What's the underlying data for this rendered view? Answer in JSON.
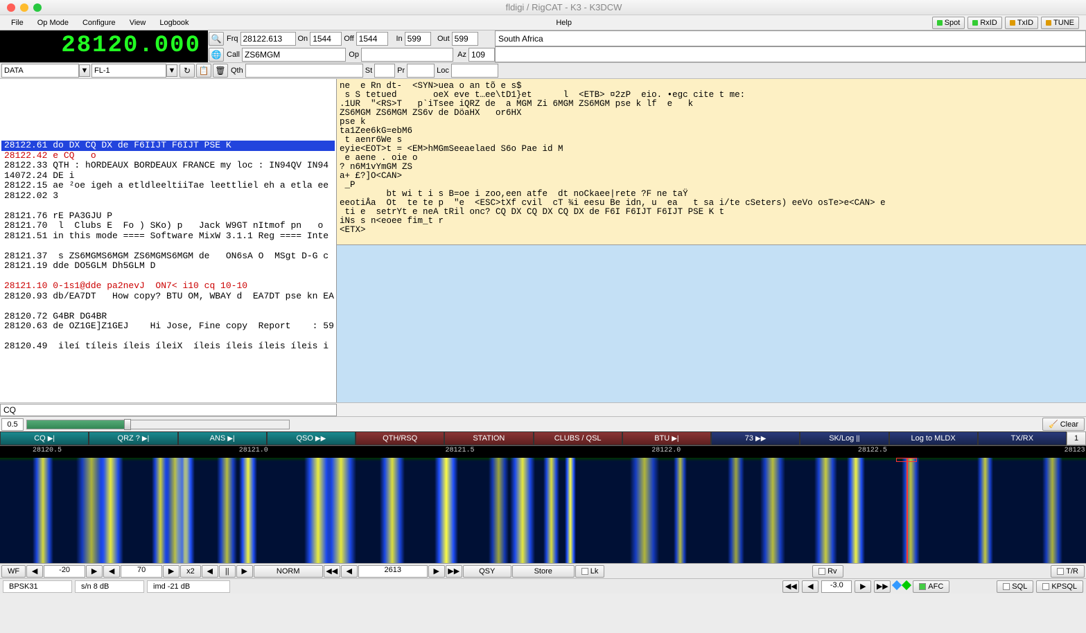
{
  "title": "fldigi / RigCAT - K3 - K3DCW",
  "menu": [
    "File",
    "Op Mode",
    "Configure",
    "View",
    "Logbook",
    "Help"
  ],
  "indicators": [
    {
      "label": "Spot",
      "led": "green"
    },
    {
      "label": "RxID",
      "led": "green"
    },
    {
      "label": "TxID",
      "led": "amber"
    },
    {
      "label": "TUNE",
      "led": "amber"
    }
  ],
  "frequency_display": "28120.000",
  "fields": {
    "frq": "28122.613",
    "on": "1544",
    "off": "1544",
    "in": "599",
    "out": "599",
    "notes": "South Africa",
    "call": "ZS6MGM",
    "op": "",
    "az": "109",
    "qth": ""
  },
  "labels": {
    "frq": "Frq",
    "on": "On",
    "off": "Off",
    "in": "In",
    "out": "Out",
    "call": "Call",
    "op": "Op",
    "az": "Az",
    "qth": "Qth",
    "st": "St",
    "pr": "Pr",
    "loc": "Loc"
  },
  "mode_dd": "DATA",
  "filter_dd": "FL-1",
  "signals": [
    {
      "t": ""
    },
    {
      "t": ""
    },
    {
      "t": ""
    },
    {
      "t": ""
    },
    {
      "t": ""
    },
    {
      "t": ""
    },
    {
      "t": "28122.61 do DX CQ DX de F6IIJT F6IJT PSE K",
      "sel": true
    },
    {
      "t": "28122.42 e CQ   o",
      "red": true
    },
    {
      "t": "28122.33 QTH : hORDEAUX BORDEAUX FRANCE my loc : IN94QV IN94"
    },
    {
      "t": "14072.24 DE i"
    },
    {
      "t": "28122.15 ae ²oe igeh a etldleeltiiTae leettliel eh a etla ee"
    },
    {
      "t": "28122.02 3"
    },
    {
      "t": ""
    },
    {
      "t": "28121.76 rE PA3GJU P"
    },
    {
      "t": "28121.70  l  Clubs E  Fo ) SKo) p   Jack W9GT nItmof pn   o"
    },
    {
      "t": "28121.51 in this mode ==== Software MixW 3.1.1 Reg ==== Inte"
    },
    {
      "t": ""
    },
    {
      "t": "28121.37  s ZS6MGMS6MGM ZS6MGMS6MGM de   ON6sA O  MSgt D-G c"
    },
    {
      "t": "28121.19 dde DO5GLM Dh5GLM D"
    },
    {
      "t": ""
    },
    {
      "t": "28121.10 0-1s1@dde pa2nevJ  ON7< i10 cq 10-10",
      "red": true
    },
    {
      "t": "28120.93 db/EA7DT   How copy? BTU OM, WBAY d  EA7DT pse kn EA"
    },
    {
      "t": ""
    },
    {
      "t": "28120.72 G4BR DG4BR"
    },
    {
      "t": "28120.63 de OZ1GE]Z1GEJ    Hi Jose, Fine copy  Report    : 59"
    },
    {
      "t": ""
    },
    {
      "t": "28120.49  ileí tíleis íleis íleiX  íleis íleis íleis íleis i"
    }
  ],
  "rxtext": "ne  e Rn dt-  <SYN>uea o an tõ e s$\n s S tetued       oeX eve t…ee\\tD1}et      l  <ETB> ¤2zP  eio. •egc cite t me:\n.1UR  \"<RS>T   p`iTsee iQRZ de  a MGM Zi 6MGM ZS6MGM pse k lf  e   k\nZS6MGM ZS6MGM ZS6v de DöaHX   or6HX\npse k\nta1Zee6kG=ebM6\n t aenr6We s\neyie<EOT>t = <EM>hMGmSeeaelaed S6o Pae id M\n e aene . oie o\n? n6M1vYmGM ZS\na+ £?]O<CAN>\n _P\n         bt wi t i s B=oe i zoo,een atfe  dt noCkaee|rete ?F ne taŸ\neeotiÅa  Ot  te te p  \"e  <ESC>tXf cvil  cT ¾i eesu Be idn, u  ea   t sa i/te cSeters) eeVo osTe>e<CAN> e\n ti e  setrYt e neA tRil onc? CQ DX CQ DX CQ DX de F6I F6IJT F6IJT PSE K t\niNs s n<eoee fim_t r\n<ETX>",
  "cq_label": "CQ",
  "slider_val": "0.5",
  "clear": "Clear",
  "macros": [
    {
      "l": "CQ",
      "s": "▶|",
      "c": "teal"
    },
    {
      "l": "QRZ ?",
      "s": "▶|",
      "c": "teal"
    },
    {
      "l": "ANS",
      "s": "▶|",
      "c": "teal"
    },
    {
      "l": "QSO",
      "s": "▶▶",
      "c": "teal"
    },
    {
      "l": "QTH/RSQ",
      "c": "red"
    },
    {
      "l": "STATION",
      "c": "red"
    },
    {
      "l": "CLUBS / QSL",
      "c": "red"
    },
    {
      "l": "BTU",
      "s": "▶|",
      "c": "red"
    },
    {
      "l": "73",
      "s": "▶▶",
      "c": "blue"
    },
    {
      "l": "SK/Log",
      "s": "||",
      "c": "blue"
    },
    {
      "l": "Log to MLDX",
      "c": "blue"
    },
    {
      "l": "TX/RX",
      "c": "blue"
    }
  ],
  "macro_page": "1",
  "scale": [
    "28120.5",
    "28121.0",
    "28121.5",
    "28122.0",
    "28122.5",
    "28123.0"
  ],
  "wf": {
    "btn_wf": "WF",
    "brightness": "-20",
    "contrast": "70",
    "speed": "x2",
    "mode": "NORM",
    "freq": "2613",
    "qsy": "QSY",
    "store": "Store",
    "lk": "Lk",
    "rv": "Rv",
    "tr": "T/R"
  },
  "status": {
    "mode": "BPSK31",
    "sn": "s/n  8 dB",
    "imd": "imd -21 dB",
    "offset": "-3.0",
    "afc": "AFC",
    "sql": "SQL",
    "kpsql": "KPSQL"
  }
}
